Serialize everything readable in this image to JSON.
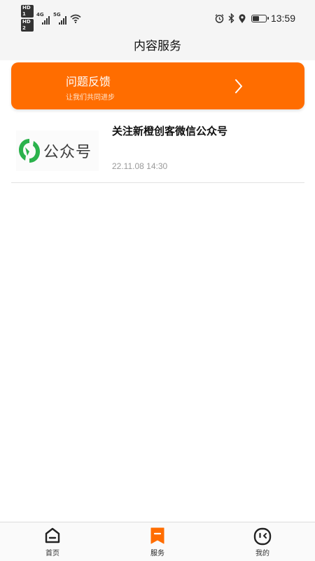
{
  "status_bar": {
    "sim1": "HD 1",
    "sim2": "HD 2",
    "net1": "4G",
    "net2": "5G",
    "time": "13:59",
    "battery_level": 0.45
  },
  "header": {
    "title": "内容服务"
  },
  "feedback_banner": {
    "title": "问题反馈",
    "subtitle": "让我们共同进步",
    "color": "#ff6d00"
  },
  "articles": [
    {
      "thumb_text": "公众号",
      "title": "关注新橙创客微信公众号",
      "date": "22.11.08 14:30"
    }
  ],
  "tab_bar": {
    "active": "服务",
    "accent_color": "#ff6d00",
    "items": [
      {
        "label": "首页",
        "icon": "home-icon"
      },
      {
        "label": "服务",
        "icon": "bookmark-icon"
      },
      {
        "label": "我的",
        "icon": "face-icon"
      }
    ]
  }
}
